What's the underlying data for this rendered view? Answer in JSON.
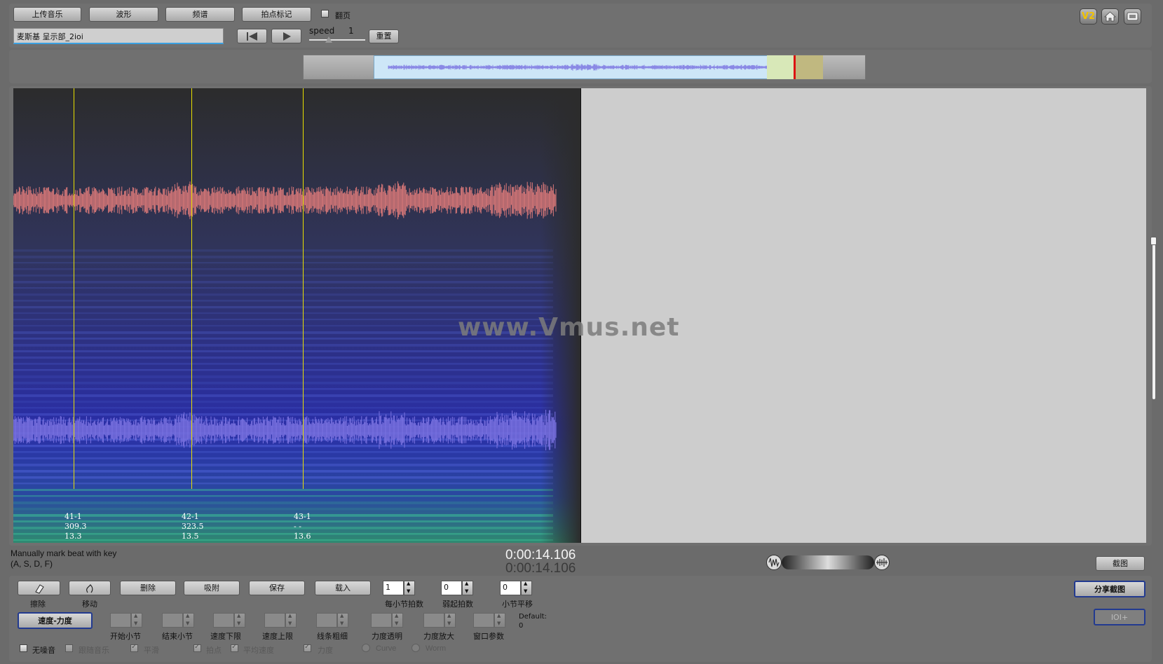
{
  "toolbar": {
    "upload_label": "上传音乐",
    "waveform_label": "波形",
    "spectrum_label": "频谱",
    "beatmark_label": "拍点标记",
    "pageturn_label": "翻页",
    "file_value": "麦斯基 呈示部_2ioi",
    "speed_label": "speed",
    "speed_value": "1",
    "speed_level": 0.3,
    "reset_label": "重置",
    "v2_label": "V2"
  },
  "overview": {
    "selection_start_pct": 0.125,
    "selection_end_pct": 0.925
  },
  "canvas": {
    "watermark": "www.Vmus.net",
    "beats": [
      {
        "line1": "41-1",
        "line2": "309.3",
        "line3": "13.3"
      },
      {
        "line1": "42-1",
        "line2": "323.5",
        "line3": "13.5"
      },
      {
        "line1": "43-1",
        "line2": "- -",
        "line3": "13.6"
      }
    ],
    "colors": {
      "upper_wave": "#d97878",
      "lower_wave": "#7a72e0",
      "beat_line": "#e8e000"
    }
  },
  "status": {
    "hint_line1": "Manually mark beat with key",
    "hint_line2": "(A, S, D, F)",
    "time1": "0:00:14.106",
    "time2": "0:00:14.106",
    "screenshot_label": "截图"
  },
  "controls": {
    "erase_label": "擦除",
    "move_label": "移动",
    "delete_label": "删除",
    "adsorb_label": "吸附",
    "save_label": "保存",
    "load_label": "载入",
    "beats_per_bar_label": "每小节拍数",
    "beats_per_bar_value": "1",
    "upbeat_label": "弱起拍数",
    "upbeat_value": "0",
    "bar_shift_label": "小节平移",
    "bar_shift_value": "0",
    "share_label": "分享截图",
    "ioi_label": "IOI+",
    "mode_label": "速度-力度",
    "start_bar_label": "开始小节",
    "end_bar_label": "结束小节",
    "speed_min_label": "速度下限",
    "speed_max_label": "速度上限",
    "line_thick_label": "线条粗细",
    "force_transparency_label": "力度透明",
    "force_zoom_label": "力度放大",
    "window_param_label": "窗口参数",
    "default_label": "Default:",
    "default_value": "0",
    "no_noise_label": "无噪音",
    "follow_music_label": "跟随音乐",
    "smooth_label": "平滑",
    "beat_label": "拍点",
    "avg_speed_label": "平均速度",
    "force_label": "力度",
    "curve_label": "Curve",
    "worm_label": "Worm"
  }
}
